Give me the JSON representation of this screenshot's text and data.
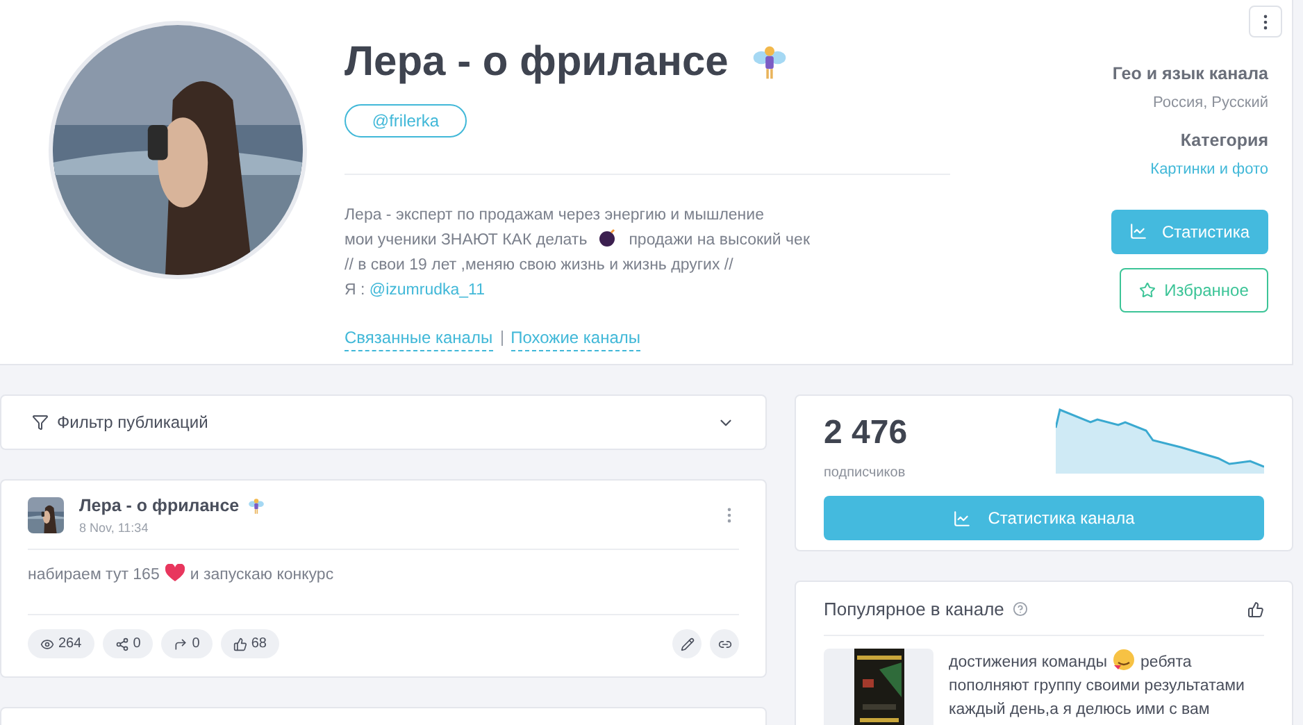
{
  "channel": {
    "title": "Лера - о фрилансе",
    "handle": "@frilerka",
    "description": [
      {
        "parts": [
          "Лера - эксперт по продажам через энергию и мышление"
        ]
      },
      {
        "parts": [
          "мои ученики ЗНАЮТ КАК делать",
          "продажи на высокий чек"
        ]
      },
      {
        "parts": [
          "// в свои 19 лет ,меняю свою жизнь и жизнь других //"
        ]
      },
      {
        "parts": [
          "Я :"
        ],
        "link": "@izumrudka_11"
      }
    ],
    "links": [
      "Связанные каналы",
      "Похожие каналы"
    ],
    "geo_label": "Гео и язык канала",
    "geo_value": "Россия, Русский",
    "category_label": "Категория",
    "category_value": "Картинки и фото",
    "stats_button": "Статистика",
    "favorite_button": "Избранное"
  },
  "filter": {
    "label": "Фильтр публикаций",
    "expanded": false
  },
  "post": {
    "author": "Лера - о фрилансе",
    "date": "8 Nov, 11:34",
    "text_parts": [
      "набираем тут 165",
      "и запускаю конкурс"
    ],
    "counters": [
      {
        "kind": "views",
        "value": "264"
      },
      {
        "kind": "shares",
        "value": "0"
      },
      {
        "kind": "forwards",
        "value": "0"
      },
      {
        "kind": "likes",
        "value": "68"
      }
    ]
  },
  "subscribers": {
    "count": "2 476",
    "label": "подписчиков",
    "button": "Статистика канала"
  },
  "popular": {
    "title": "Популярное в канале",
    "items": [
      {
        "kind": "picture",
        "text_parts": [
          "достижения команды",
          "ребята пополняют группу своими результатами",
          "каждый день,а я делюсь ими с вам"
        ]
      }
    ]
  }
}
